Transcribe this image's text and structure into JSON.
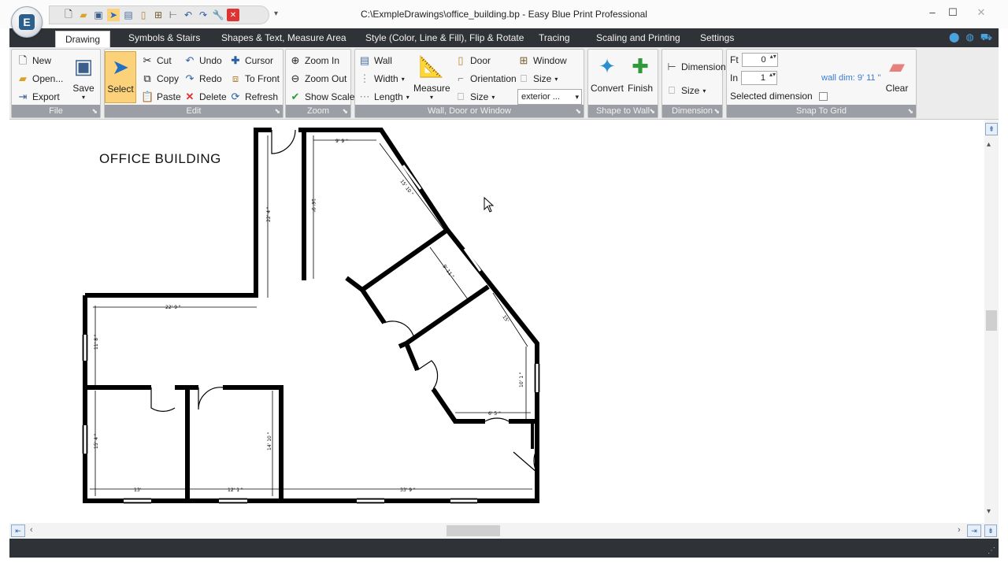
{
  "window": {
    "title": "C:\\ExmpleDrawings\\office_building.bp - Easy Blue Print Professional",
    "minimize": "–",
    "maximize": "☐",
    "close": "✕"
  },
  "tabs": [
    {
      "label": "Drawing"
    },
    {
      "label": "Symbols & Stairs"
    },
    {
      "label": "Shapes & Text, Measure Area"
    },
    {
      "label": "Style (Color, Line & Fill), Flip & Rotate"
    },
    {
      "label": "Tracing"
    },
    {
      "label": "Scaling and Printing"
    },
    {
      "label": "Settings"
    }
  ],
  "ribbon": {
    "file": {
      "label": "File",
      "new": "New",
      "open": "Open...",
      "export": "Export",
      "save": "Save"
    },
    "edit": {
      "label": "Edit",
      "select": "Select",
      "cut": "Cut",
      "copy": "Copy",
      "paste": "Paste",
      "undo": "Undo",
      "redo": "Redo",
      "delete": "Delete",
      "cursor": "Cursor",
      "to_front": "To Front",
      "refresh": "Refresh"
    },
    "zoom": {
      "label": "Zoom",
      "zoom_in": "Zoom In",
      "zoom_out": "Zoom Out",
      "show_scale": "Show Scale"
    },
    "wall": {
      "label": "Wall, Door or Window",
      "wall": "Wall",
      "width": "Width",
      "length": "Length",
      "measure": "Measure",
      "door": "Door",
      "orientation": "Orientation",
      "size": "Size",
      "window": "Window",
      "window_size": "Size",
      "type_value": "exterior ..."
    },
    "shape_to_wall": {
      "label": "Shape to Wall",
      "convert": "Convert",
      "finish": "Finish"
    },
    "dimension": {
      "label": "Dimension",
      "dimension": "Dimension",
      "size": "Size"
    },
    "snap": {
      "label": "Snap To Grid",
      "ft_label": "Ft",
      "ft_value": "0",
      "in_label": "In",
      "in_value": "1",
      "wall_dim": "wall dim: 9' 11 \"",
      "selected_dimension": "Selected dimension",
      "clear": "Clear"
    }
  },
  "plan": {
    "title": "OFFICE BUILDING",
    "dimensions": {
      "top_room_width": "9' 9 \"",
      "diag_upper": "15' 10 \"",
      "left_vertical": "22' 4 \"",
      "inner_vertical": "16' 9\"",
      "mid_diag": "9' 11 \"",
      "right_diag": "15'",
      "left_horizontal": "22' 9 \"",
      "left_wall": "11' 8 \"",
      "right_vertical": "10' 1 \"",
      "small_horizontal": "6' 5 \"",
      "bottom_left_vertical": "15' 4 \"",
      "bottom_mid_vertical": "14' 10 \"",
      "bottom_left_horizontal": "13'",
      "bottom_mid_horizontal": "12' 1 \"",
      "bottom_right_horizontal": "33' 9 \""
    }
  },
  "colors": {
    "accent": "#3a7bd5",
    "ribbon_dark": "#2f3237",
    "group_label": "#9b9fa5",
    "select_highlight": "#fbd27a"
  }
}
